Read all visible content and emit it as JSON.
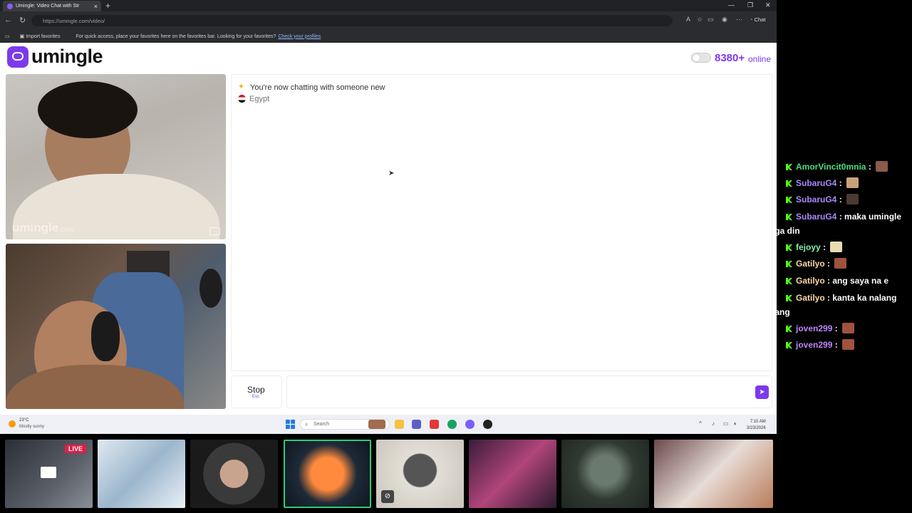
{
  "browser": {
    "tab_title": "Umingle: Video Chat with Str",
    "tab_close": "×",
    "new_tab": "+",
    "url": "https://umingle.com/video/",
    "chat_button": "Chat",
    "favorites": {
      "import_label": "Import favorites",
      "hint": "For quick access, place your favorites here on the favorites bar. Looking for your favorites?",
      "link": "Check your profiles"
    }
  },
  "site": {
    "logo_text": "umingle",
    "online_count": "8380+",
    "online_label": "online",
    "watermark": "umingle",
    "watermark_suffix": ".com"
  },
  "chat": {
    "system_message": "You're now chatting with someone new",
    "country": "Egypt",
    "stop_label": "Stop",
    "stop_key": "Esc",
    "input_value": ""
  },
  "taskbar": {
    "weather_temp": "23°C",
    "weather_desc": "Mostly sunny",
    "search_placeholder": "Search",
    "time": "7:10 AM",
    "date": "3/23/2026"
  },
  "stream": {
    "live_badge": "LIVE"
  },
  "stream_chat": [
    {
      "user": "AmorVincit0mnia",
      "color": "#4ade80",
      "text": "",
      "emote": "#8b5a4a"
    },
    {
      "user": "SubaruG4",
      "color": "#a78bfa",
      "text": "",
      "emote": "#c9a27a"
    },
    {
      "user": "SubaruG4",
      "color": "#a78bfa",
      "text": "",
      "emote": "#4b3a33"
    },
    {
      "user": "SubaruG4",
      "color": "#a78bfa",
      "text": "maka umingle",
      "cont": "nga din"
    },
    {
      "user": "fejoyy",
      "color": "#86efac",
      "text": "",
      "emote": "#e8dcb0"
    },
    {
      "user": "Gatilyo",
      "color": "#fcd9a8",
      "text": "",
      "emote": "#a0523d"
    },
    {
      "user": "Gatilyo",
      "color": "#fcd9a8",
      "text": "ang saya na e"
    },
    {
      "user": "Gatilyo",
      "color": "#fcd9a8",
      "text": "kanta ka nalang",
      "cont": "nang"
    },
    {
      "user": "joven299",
      "color": "#c084fc",
      "text": "",
      "emote": "#a0523d"
    },
    {
      "user": "joven299",
      "color": "#c084fc",
      "text": "",
      "emote": "#a0523d"
    }
  ]
}
